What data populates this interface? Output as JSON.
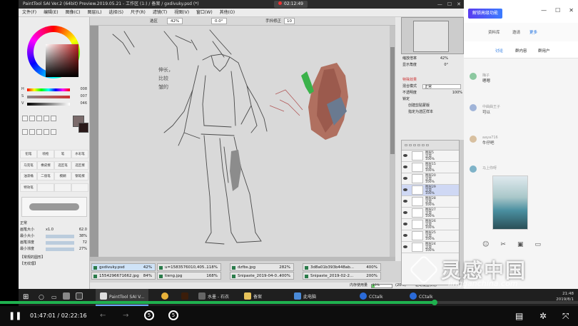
{
  "sai": {
    "title": "PaintTool SAI Ver.2 (64bit) Preview.2019.05.21 - 工作区 (1:) / 备案 / gxdivuky.psd (*)",
    "timer": "02:12:49",
    "menu": [
      "文件(F)",
      "编辑(E)",
      "图像(C)",
      "图层(L)",
      "选择(S)",
      "尺子(R)",
      "滤镜(T)",
      "视图(V)",
      "窗口(W)",
      "其他(O)"
    ],
    "toolbar": {
      "select_label": "选区",
      "zoom": "42%",
      "angle": "0.0°",
      "stabilizer_label": "手抖修正",
      "stabilizer": "10"
    },
    "color": {
      "h_label": "H",
      "h_value": "008",
      "s_label": "S",
      "s_value": "007",
      "v_label": "V",
      "v_value": "046",
      "current": "#7a6a6a",
      "background": "#2a1a1a"
    },
    "brushes": [
      "铅笔",
      "喷枪",
      "笔",
      "水彩笔",
      "马克笔",
      "橡皮擦",
      "选区笔",
      "选区擦",
      "油漆桶",
      "二值笔",
      "模糊",
      "钢笔擦",
      "特效笔",
      "",
      "",
      ""
    ],
    "props": {
      "mode": "正常",
      "size_label": "画笔大小",
      "size_mult": "x1.0",
      "size": "62.0",
      "min_size_label": "最小大小",
      "min_size": "38%",
      "density_label": "画笔浓度",
      "density": "72",
      "min_density_label": "最小浓度",
      "min_density": "27%",
      "shape_label": "【常规的圆形】",
      "texture_label": "【无纹理】"
    },
    "navigator": {
      "zoom_label": "缩放倍率",
      "zoom": "42%",
      "angle_label": "显示角度",
      "angle": "0°"
    },
    "layer_panel": {
      "effect_label": "特殊效果",
      "blend_label": "混合模式",
      "blend": "正常",
      "opacity_label": "不透明度",
      "opacity": "100%",
      "lock_label": "锁定",
      "clip_label": "创建剪贴蒙版",
      "ref_label": "指定为选区样本"
    },
    "layers": [
      {
        "name": "图层5",
        "mode": "正常",
        "opacity": "100%"
      },
      {
        "name": "图层15",
        "mode": "正常",
        "opacity": "100%"
      },
      {
        "name": "图层20",
        "mode": "正常",
        "opacity": "100%"
      },
      {
        "name": "图层29",
        "mode": "正常",
        "opacity": "100%"
      },
      {
        "name": "图层28",
        "mode": "正常",
        "opacity": "100%"
      },
      {
        "name": "图层27",
        "mode": "正常",
        "opacity": "100%"
      },
      {
        "name": "图层26",
        "mode": "正常",
        "opacity": "100%"
      },
      {
        "name": "图层25",
        "mode": "正常",
        "opacity": "100%"
      },
      {
        "name": "图层24",
        "mode": "正常",
        "opacity": "100%"
      }
    ],
    "tabs": [
      {
        "name": "gxdivuky.psd",
        "pct": "42%"
      },
      {
        "name": "u=1583576010,405...",
        "pct": "118%"
      },
      {
        "name": "dzfbs.jpg",
        "pct": "282%"
      },
      {
        "name": "3d8a01b393b448ab...",
        "pct": "400%"
      },
      {
        "name": "1554296671662.jpg",
        "pct": "84%"
      },
      {
        "name": "tieng.jpg",
        "pct": "168%"
      },
      {
        "name": "Snipaste_2019-04-0...",
        "pct": "400%"
      },
      {
        "name": "Snipaste_2019-02-2...",
        "pct": "200%"
      }
    ],
    "status": {
      "mem_label": "内存使用量",
      "mem_value": "19%",
      "mem_value2": "(20%)",
      "key_label": "驱动键盘状态"
    },
    "notes": "伸长，\n比较\n皱的"
  },
  "chat": {
    "banner": "解锁高级功能",
    "sub": {
      "left": "资料库",
      "mid": "邀请",
      "right": "更多"
    },
    "tabs": [
      "讨论",
      "群内容",
      "群用户"
    ],
    "messages": [
      {
        "name": "梅子",
        "text": "嗯嗯"
      },
      {
        "name": "中曲曲王子",
        "text": "可以"
      },
      {
        "name": "aaya716",
        "text": "牛仔吧"
      },
      {
        "name": "马上你呀",
        "text": ""
      }
    ]
  },
  "taskbar": {
    "items": [
      "PaintTool SAI V...",
      "水墨 - 石衣",
      "备案",
      "此电脑",
      "CCtalk",
      "CCtalk"
    ],
    "time": "21:48",
    "date": "2019/8/1"
  },
  "player": {
    "current": "01:47:01",
    "total": "02:22:16",
    "skip_back": "5",
    "skip_fwd": "5",
    "progress": 0.752
  },
  "watermark": {
    "cn": "灵感中国",
    "en": "lingganchina.com"
  }
}
